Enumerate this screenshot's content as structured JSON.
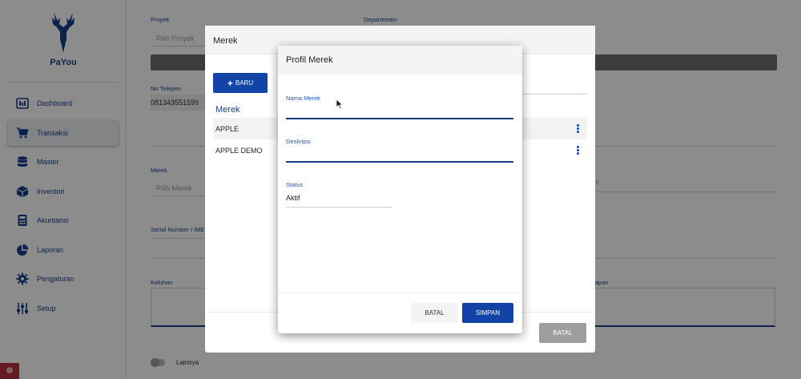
{
  "brand": {
    "name_prefix": "Pa",
    "name_suffix": "You"
  },
  "sidebar": {
    "items": [
      {
        "label": "Dashboard",
        "icon": "dashboard-icon"
      },
      {
        "label": "Transaksi",
        "icon": "cart-icon",
        "active": true
      },
      {
        "label": "Master",
        "icon": "database-icon"
      },
      {
        "label": "Inventori",
        "icon": "box-icon"
      },
      {
        "label": "Akuntansi",
        "icon": "calculator-icon"
      },
      {
        "label": "Laporan",
        "icon": "pie-chart-icon"
      },
      {
        "label": "Pengaturan",
        "icon": "gear-icon"
      },
      {
        "label": "Setup",
        "icon": "sliders-icon"
      }
    ]
  },
  "form": {
    "proyek_label": "Proyek",
    "proyek_placeholder": "Pilih Proyek",
    "departemen_label": "Departemen",
    "telepon_label": "No Telepon",
    "telepon_value": "081343551599",
    "merek_label": "Merek",
    "merek_placeholder": "Pilih Merek",
    "serial_label": "Serial Number / IMEI",
    "seri_fragment": "eri",
    "keluhan_label": "Keluhan",
    "kelengkapan_fragment": "kapan",
    "lainnya_label": "Lainnya"
  },
  "merek_modal": {
    "title": "Merek",
    "new_button": "BARU",
    "list_header": "Merek",
    "rows": [
      "APPLE",
      "APPLE DEMO"
    ],
    "cancel_button": "BATAL"
  },
  "profil_modal": {
    "title": "Profil Merek",
    "nama_label": "Nama Merek",
    "nama_value": "",
    "deskripsi_label": "Deskripsi",
    "deskripsi_value": "",
    "status_label": "Status",
    "status_value": "Aktif",
    "cancel_button": "BATAL",
    "save_button": "SIMPAN"
  },
  "colors": {
    "primary": "#1244a8",
    "accent_text": "#173f8a",
    "laravel": "#b8323a"
  }
}
